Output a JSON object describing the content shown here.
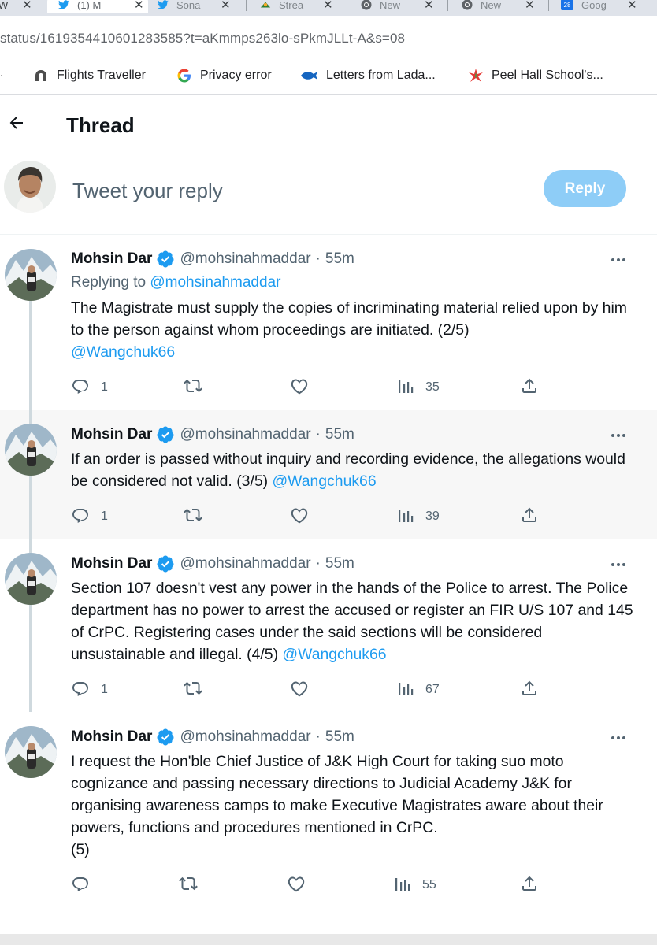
{
  "browser": {
    "tabs": [
      {
        "label": "W",
        "icon": "generic-page-icon"
      },
      {
        "label": "(1) M",
        "icon": "twitter-bird-icon",
        "active": true
      },
      {
        "label": "Sona",
        "icon": "twitter-bird-icon"
      },
      {
        "label": "Strea",
        "icon": "stream-icon"
      },
      {
        "label": "New",
        "icon": "chrome-icon"
      },
      {
        "label": "New",
        "icon": "chrome-icon"
      },
      {
        "label": "Goog",
        "icon": "google-calendar-icon",
        "badge": "28"
      }
    ],
    "url": "status/1619354410601283585?t=aKmmps263lo-sPkmJLLt-A&s=08",
    "bookmarks": [
      {
        "label": "Flights Traveller",
        "icon": "flights-icon"
      },
      {
        "label": "Privacy error",
        "icon": "google-g-icon"
      },
      {
        "label": "Letters from Lada...",
        "icon": "fish-icon"
      },
      {
        "label": "Peel Hall School's...",
        "icon": "leaf-icon"
      }
    ]
  },
  "header": {
    "title": "Thread"
  },
  "composer": {
    "placeholder": "Tweet your reply",
    "reply_label": "Reply"
  },
  "tweets": [
    {
      "name": "Mohsin Dar",
      "handle": "@mohsinahmaddar",
      "dot": "·",
      "time": "55m",
      "replying_prefix": "Replying to",
      "replying_to": "@mohsinahmaddar",
      "text": "The Magistrate must supply the copies of incriminating material relied upon by him to the person against whom proceedings are initiated. (2/5)",
      "mention": "@Wangchuk66",
      "replies": "1",
      "retweets": "",
      "likes": "",
      "views": "35"
    },
    {
      "name": "Mohsin Dar",
      "handle": "@mohsinahmaddar",
      "dot": "·",
      "time": "55m",
      "text": "If an order is passed without inquiry and recording evidence, the allegations would be considered not valid. (3/5)",
      "mention": "@Wangchuk66",
      "replies": "1",
      "retweets": "",
      "likes": "",
      "views": "39"
    },
    {
      "name": "Mohsin Dar",
      "handle": "@mohsinahmaddar",
      "dot": "·",
      "time": "55m",
      "text": "Section 107 doesn't vest any power in the hands of the Police to arrest. The Police department has no power to arrest the accused or register an FIR U/S 107 and 145 of CrPC. Registering cases under the said sections will be considered unsustainable and illegal. (4/5)",
      "mention": "@Wangchuk66",
      "replies": "1",
      "retweets": "",
      "likes": "",
      "views": "67"
    },
    {
      "name": "Mohsin Dar",
      "handle": "@mohsinahmaddar",
      "dot": "·",
      "time": "55m",
      "text": "I request the Hon'ble Chief Justice of J&K High Court for taking suo moto cognizance and passing necessary directions to Judicial Academy J&K for organising awareness camps to make Executive Magistrates aware about their powers, functions and procedures mentioned in CrPC.",
      "text2": "(5)",
      "replies": "",
      "retweets": "",
      "likes": "",
      "views": "55"
    }
  ],
  "colors": {
    "accent": "#1d9bf0",
    "reply_button_disabled": "#8ecdf7",
    "secondary_text": "#536471",
    "highlight_bg": "#f7f7f7"
  }
}
